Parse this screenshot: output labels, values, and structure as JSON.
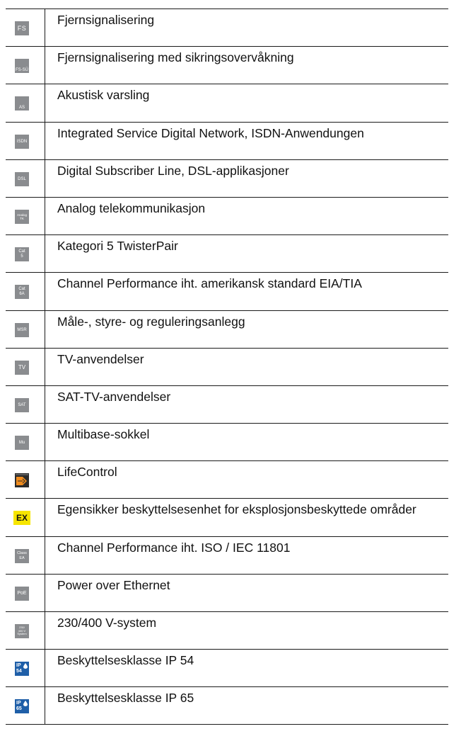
{
  "rows": [
    {
      "icon": "fs-remote-signaling-icon",
      "icon_text": "FS",
      "label": "Fjernsignalisering"
    },
    {
      "icon": "fs-su-fuse-monitoring-icon",
      "icon_text": "FS-SÜ",
      "label": "Fjernsignalisering med sikringsovervåkning"
    },
    {
      "icon": "as-acoustic-warning-icon",
      "icon_text": "AS",
      "label": "Akustisk varsling"
    },
    {
      "icon": "isdn-icon",
      "icon_text": "ISDN",
      "label": "Integrated Service Digital Network, ISDN-Anwendungen"
    },
    {
      "icon": "dsl-icon",
      "icon_text": "DSL",
      "label": "Digital Subscriber Line, DSL-applikasjoner"
    },
    {
      "icon": "analog-tk-icon",
      "icon_text": "Analog\nTK",
      "label": "Analog telekommunikasjon"
    },
    {
      "icon": "cat5-icon",
      "icon_text": "Cat\n5",
      "label": "Kategori 5 TwisterPair"
    },
    {
      "icon": "cat6a-icon",
      "icon_text": "Cat\n6A",
      "label": "Channel Performance iht. amerikansk standard EIA/TIA"
    },
    {
      "icon": "msr-icon",
      "icon_text": "MSR",
      "label": "Måle-, styre- og reguleringsanlegg"
    },
    {
      "icon": "tv-icon",
      "icon_text": "TV",
      "label": "TV-anvendelser"
    },
    {
      "icon": "sat-icon",
      "icon_text": "SAT",
      "label": "SAT-TV-anvendelser"
    },
    {
      "icon": "mu-multibase-icon",
      "icon_text": "Mu",
      "label": "Multibase-sokkel"
    },
    {
      "icon": "lifecontrol-icon",
      "icon_text": "",
      "label": "LifeControl"
    },
    {
      "icon": "ex-explosion-protection-icon",
      "icon_text": "EX",
      "label": "Egensikker beskyttelsesenhet for eksplosjonsbeskyttede områder"
    },
    {
      "icon": "class-ea-icon",
      "icon_text": "Class\nEA",
      "label": "Channel Performance iht. ISO / IEC 11801"
    },
    {
      "icon": "poe-icon",
      "icon_text": "PoE",
      "label": "Power over Ethernet"
    },
    {
      "icon": "230-400v-system-icon",
      "icon_text": "230/\n400 V\nSystem",
      "label": "230/400 V-system"
    },
    {
      "icon": "ip54-icon",
      "icon_text": "IP\n54",
      "label": "Beskyttelsesklasse IP 54"
    },
    {
      "icon": "ip65-icon",
      "icon_text": "IP\n65",
      "label": "Beskyttelsesklasse IP 65"
    }
  ]
}
